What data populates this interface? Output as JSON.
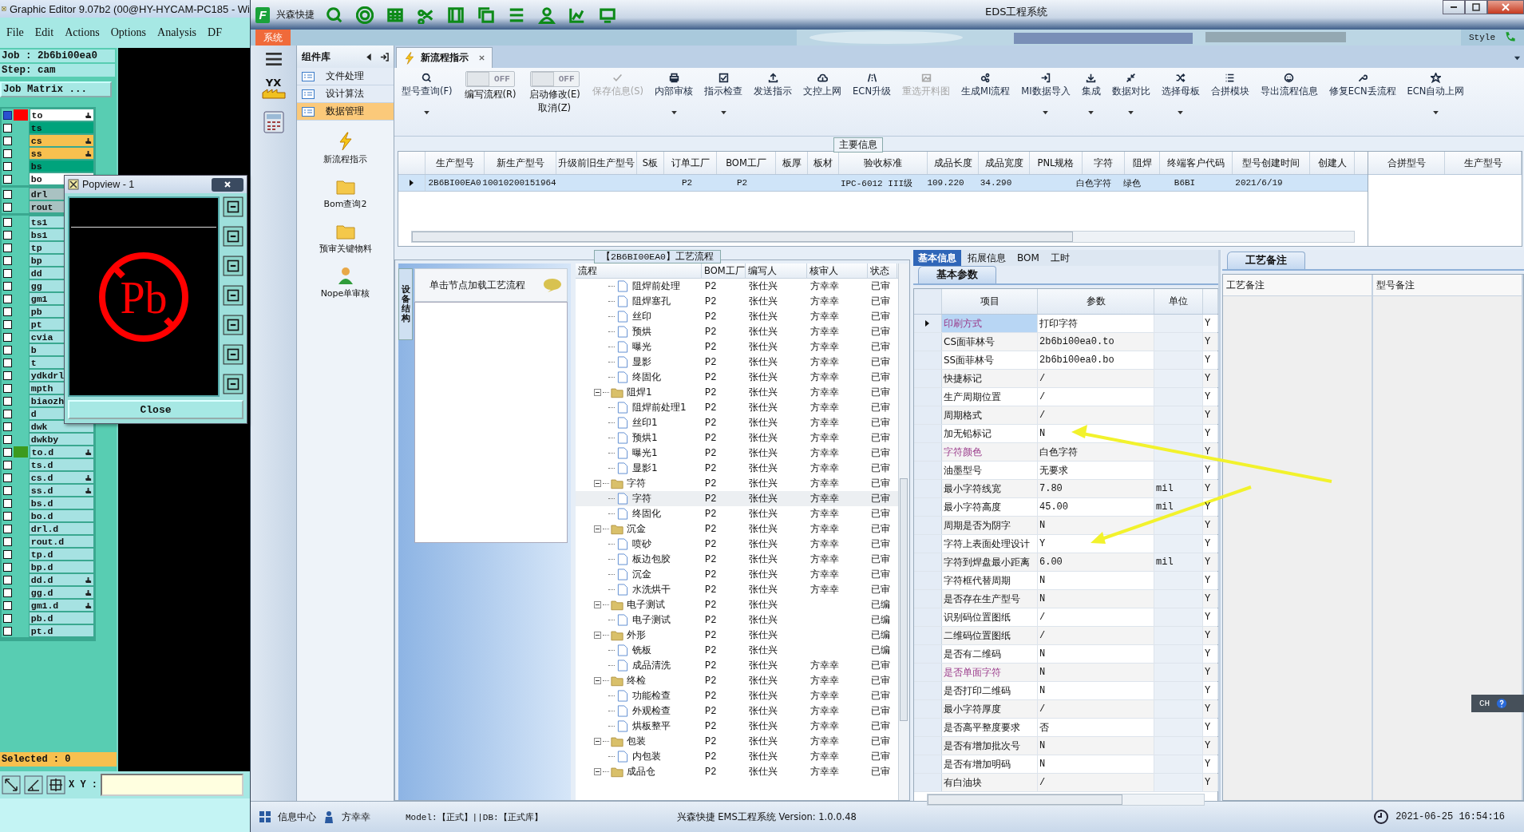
{
  "editor": {
    "title": "Graphic Editor 9.07b2 (00@HY-HYCAM-PC185 - Wi",
    "menu": [
      "File",
      "Edit",
      "Actions",
      "Options",
      "Analysis",
      "DF"
    ],
    "job": "Job : 2b6bi00ea0",
    "step": "Step: cam",
    "matrix_button": "Job Matrix ...",
    "layer_groups": [
      [
        {
          "name": "to",
          "color": "#ffffff",
          "swatch": {
            "color": "#ff0000"
          },
          "hand": true,
          "checked": true
        },
        {
          "name": "ts",
          "color": "#00a37c",
          "hand": false,
          "checked": false
        },
        {
          "name": "cs",
          "color": "#f7c04f",
          "hand": true,
          "checked": false
        },
        {
          "name": "ss",
          "color": "#f7c04f",
          "hand": true,
          "checked": false
        },
        {
          "name": "bs",
          "color": "#00a37c",
          "hand": false,
          "checked": false
        },
        {
          "name": "bo",
          "color": "#ffffff",
          "hand": false,
          "checked": false
        }
      ],
      [
        {
          "name": "drl",
          "color": "#a9c2c2",
          "hand": false,
          "checked": false
        },
        {
          "name": "rout",
          "color": "#a9c2c2",
          "hand": false,
          "checked": false
        }
      ],
      [
        {
          "name": "ts1",
          "color": "#a6e2e2",
          "hand": false,
          "checked": false
        },
        {
          "name": "bs1",
          "color": "#a6e2e2",
          "hand": false,
          "checked": false
        },
        {
          "name": "tp",
          "color": "#a6e2e2",
          "hand": false,
          "checked": false
        },
        {
          "name": "bp",
          "color": "#a6e2e2",
          "hand": false,
          "checked": false
        },
        {
          "name": "dd",
          "color": "#a6e2e2",
          "hand": false,
          "checked": false
        },
        {
          "name": "gg",
          "color": "#a6e2e2",
          "hand": false,
          "checked": false
        },
        {
          "name": "gm1",
          "color": "#a6e2e2",
          "hand": false,
          "checked": false
        },
        {
          "name": "pb",
          "color": "#a6e2e2",
          "hand": false,
          "checked": false
        },
        {
          "name": "pt",
          "color": "#a6e2e2",
          "hand": false,
          "checked": false
        },
        {
          "name": "cvia",
          "color": "#a6e2e2",
          "hand": false,
          "checked": false
        },
        {
          "name": "b",
          "color": "#a6e2e2",
          "hand": false,
          "checked": false
        },
        {
          "name": "t",
          "color": "#a6e2e2",
          "hand": false,
          "checked": false
        },
        {
          "name": "ydkdrl",
          "color": "#a6e2e2",
          "hand": false,
          "checked": false
        },
        {
          "name": "mpth",
          "color": "#a6e2e2",
          "hand": false,
          "checked": false
        },
        {
          "name": "biaozh",
          "color": "#a6e2e2",
          "hand": false,
          "checked": false
        },
        {
          "name": "d",
          "color": "#a6e2e2",
          "hand": false,
          "checked": false
        },
        {
          "name": "dwk",
          "color": "#a6e2e2",
          "hand": false,
          "checked": false
        },
        {
          "name": "dwkby",
          "color": "#a6e2e2",
          "hand": false,
          "checked": false
        },
        {
          "name": "to.d",
          "color": "#a6e2e2",
          "swatch": {
            "color": "#3c9a1e"
          },
          "hand": true,
          "checked": false
        },
        {
          "name": "ts.d",
          "color": "#a6e2e2",
          "hand": false,
          "checked": false
        },
        {
          "name": "cs.d",
          "color": "#a6e2e2",
          "hand": true,
          "checked": false
        },
        {
          "name": "ss.d",
          "color": "#a6e2e2",
          "hand": true,
          "checked": false
        },
        {
          "name": "bs.d",
          "color": "#a6e2e2",
          "hand": false,
          "checked": false
        },
        {
          "name": "bo.d",
          "color": "#a6e2e2",
          "hand": false,
          "checked": false
        },
        {
          "name": "drl.d",
          "color": "#a6e2e2",
          "hand": false,
          "checked": false
        },
        {
          "name": "rout.d",
          "color": "#a6e2e2",
          "hand": false,
          "checked": false
        },
        {
          "name": "tp.d",
          "color": "#a6e2e2",
          "hand": false,
          "checked": false
        },
        {
          "name": "bp.d",
          "color": "#a6e2e2",
          "hand": false,
          "checked": false
        },
        {
          "name": "dd.d",
          "color": "#a6e2e2",
          "hand": true,
          "checked": false
        },
        {
          "name": "gg.d",
          "color": "#a6e2e2",
          "hand": true,
          "checked": false
        },
        {
          "name": "gm1.d",
          "color": "#a6e2e2",
          "hand": true,
          "checked": false
        },
        {
          "name": "pb.d",
          "color": "#a6e2e2",
          "hand": false,
          "checked": false
        },
        {
          "name": "pt.d",
          "color": "#a6e2e2",
          "hand": false,
          "checked": false
        }
      ]
    ],
    "selected_count": "Selected : 0",
    "xy_label": "X Y :",
    "popview": {
      "title": "Popview - 1",
      "symbol": "Pb",
      "close_button": "Close"
    }
  },
  "app": {
    "logo": "F",
    "brand": "兴森快捷",
    "title": "EDS工程系统",
    "system_tab": "系统",
    "style_menu": "Style",
    "yx_logo": "YX"
  },
  "components": {
    "title": "组件库",
    "items": [
      {
        "label": "文件处理",
        "selected": false
      },
      {
        "label": "设计算法",
        "selected": false
      },
      {
        "label": "数据管理",
        "selected": true
      }
    ],
    "tools": [
      "新流程指示",
      "Bom查询2",
      "预审关键物料",
      "Nope单审核"
    ]
  },
  "doc_tab": "新流程指示",
  "toolbar": [
    {
      "kind": "button",
      "lines": [
        "型号查询(F)"
      ],
      "dropdown": true,
      "disabled": false
    },
    {
      "kind": "toggle",
      "toggle_text": "OFF",
      "on": false,
      "lines": [
        "编写流程(R)"
      ]
    },
    {
      "kind": "toggle",
      "toggle_text": "OFF",
      "on": false,
      "lines": [
        "启动修改(E)",
        "取消(Z)"
      ]
    },
    {
      "kind": "button",
      "lines": [
        "保存信息(S)"
      ],
      "dropdown": false,
      "disabled": true
    },
    {
      "kind": "button",
      "lines": [
        "内部审核"
      ],
      "dropdown": true,
      "disabled": false
    },
    {
      "kind": "button",
      "lines": [
        "指示检查"
      ],
      "dropdown": true,
      "disabled": false
    },
    {
      "kind": "button",
      "lines": [
        "发送指示"
      ],
      "dropdown": false,
      "disabled": false
    },
    {
      "kind": "button",
      "lines": [
        "文控上网"
      ],
      "dropdown": false,
      "disabled": false
    },
    {
      "kind": "button",
      "lines": [
        "ECN升级"
      ],
      "dropdown": false,
      "disabled": false
    },
    {
      "kind": "button",
      "lines": [
        "重选开料图"
      ],
      "dropdown": false,
      "disabled": true
    },
    {
      "kind": "button",
      "lines": [
        "生成MI流程"
      ],
      "dropdown": false,
      "disabled": false
    },
    {
      "kind": "button",
      "lines": [
        "MI数据导入"
      ],
      "dropdown": true,
      "disabled": false
    },
    {
      "kind": "button",
      "lines": [
        "集成"
      ],
      "dropdown": true,
      "disabled": false
    },
    {
      "kind": "button",
      "lines": [
        "数据对比"
      ],
      "dropdown": true,
      "disabled": false
    },
    {
      "kind": "button",
      "lines": [
        "选择母板"
      ],
      "dropdown": true,
      "disabled": false
    },
    {
      "kind": "button",
      "lines": [
        "合拼模块"
      ],
      "dropdown": false,
      "disabled": false
    },
    {
      "kind": "button",
      "lines": [
        "导出流程信息"
      ],
      "dropdown": false,
      "disabled": false
    },
    {
      "kind": "button",
      "lines": [
        "修复ECN丢流程"
      ],
      "dropdown": false,
      "disabled": false
    },
    {
      "kind": "button",
      "lines": [
        "ECN自动上网"
      ],
      "dropdown": true,
      "disabled": false
    }
  ],
  "main_info": {
    "title": "主要信息",
    "columns": [
      {
        "header": "生产型号",
        "value": "2B6BI00EA0"
      },
      {
        "header": "新生产型号",
        "value": "10010200151964"
      },
      {
        "header": "升级前旧生产型号"
      },
      {
        "header": "S板"
      },
      {
        "header": "订单工厂",
        "value": "P2"
      },
      {
        "header": "BOM工厂",
        "value": "P2"
      },
      {
        "header": "板厚"
      },
      {
        "header": "板材"
      },
      {
        "header": "验收标准",
        "value": "IPC-6012 III级"
      },
      {
        "header": "成品长度",
        "value": "109.220"
      },
      {
        "header": "成品宽度",
        "value": "34.290"
      },
      {
        "header": "PNL规格"
      },
      {
        "header": "字符",
        "value": "白色字符"
      },
      {
        "header": "阻焊",
        "value": "绿色"
      },
      {
        "header": "终端客户代码",
        "value": "B6BI"
      },
      {
        "header": "型号创建时间",
        "value": "2021/6/19"
      },
      {
        "header": "创建人"
      }
    ],
    "side_columns": [
      "合拼型号",
      "生产型号"
    ]
  },
  "process": {
    "title": "【2B6BI00EA0】工艺流程",
    "side_tab": "设备结构",
    "hint": "单击节点加载工艺流程",
    "columns": [
      "流程",
      "BOM工厂",
      "编写人",
      "核审人",
      "状态"
    ],
    "rows": [
      {
        "kind": "step",
        "name": "阻焊前处理",
        "bom": "P2",
        "writer": "张仕兴",
        "reviewer": "方幸幸",
        "status": "已审",
        "selected": false
      },
      {
        "kind": "step",
        "name": "阻焊塞孔",
        "bom": "P2",
        "writer": "张仕兴",
        "reviewer": "方幸幸",
        "status": "已审",
        "selected": false
      },
      {
        "kind": "step",
        "name": "丝印",
        "bom": "P2",
        "writer": "张仕兴",
        "reviewer": "方幸幸",
        "status": "已审",
        "selected": false
      },
      {
        "kind": "step",
        "name": "预烘",
        "bom": "P2",
        "writer": "张仕兴",
        "reviewer": "方幸幸",
        "status": "已审",
        "selected": false
      },
      {
        "kind": "step",
        "name": "曝光",
        "bom": "P2",
        "writer": "张仕兴",
        "reviewer": "方幸幸",
        "status": "已审",
        "selected": false
      },
      {
        "kind": "step",
        "name": "显影",
        "bom": "P2",
        "writer": "张仕兴",
        "reviewer": "方幸幸",
        "status": "已审",
        "selected": false
      },
      {
        "kind": "step",
        "name": "终固化",
        "bom": "P2",
        "writer": "张仕兴",
        "reviewer": "方幸幸",
        "status": "已审",
        "selected": false
      },
      {
        "kind": "group",
        "name": "阻焊1",
        "bom": "P2",
        "writer": "张仕兴",
        "reviewer": "方幸幸",
        "status": "已审",
        "selected": false,
        "expanded": true,
        "children": [
          {
            "kind": "step",
            "name": "阻焊前处理1",
            "bom": "P2",
            "writer": "张仕兴",
            "reviewer": "方幸幸",
            "status": "已审",
            "selected": false
          },
          {
            "kind": "step",
            "name": "丝印1",
            "bom": "P2",
            "writer": "张仕兴",
            "reviewer": "方幸幸",
            "status": "已审",
            "selected": false
          },
          {
            "kind": "step",
            "name": "预烘1",
            "bom": "P2",
            "writer": "张仕兴",
            "reviewer": "方幸幸",
            "status": "已审",
            "selected": false
          },
          {
            "kind": "step",
            "name": "曝光1",
            "bom": "P2",
            "writer": "张仕兴",
            "reviewer": "方幸幸",
            "status": "已审",
            "selected": false
          },
          {
            "kind": "step",
            "name": "显影1",
            "bom": "P2",
            "writer": "张仕兴",
            "reviewer": "方幸幸",
            "status": "已审",
            "selected": false
          }
        ]
      },
      {
        "kind": "group",
        "name": "字符",
        "bom": "P2",
        "writer": "张仕兴",
        "reviewer": "方幸幸",
        "status": "已审",
        "selected": false,
        "expanded": true,
        "children": [
          {
            "kind": "step",
            "name": "字符",
            "bom": "P2",
            "writer": "张仕兴",
            "reviewer": "方幸幸",
            "status": "已审",
            "selected": true
          },
          {
            "kind": "step",
            "name": "终固化",
            "bom": "P2",
            "writer": "张仕兴",
            "reviewer": "方幸幸",
            "status": "已审",
            "selected": false
          }
        ]
      },
      {
        "kind": "group",
        "name": "沉金",
        "bom": "P2",
        "writer": "张仕兴",
        "reviewer": "方幸幸",
        "status": "已审",
        "selected": false,
        "expanded": true,
        "children": [
          {
            "kind": "step",
            "name": "喷砂",
            "bom": "P2",
            "writer": "张仕兴",
            "reviewer": "方幸幸",
            "status": "已审",
            "selected": false
          },
          {
            "kind": "step",
            "name": "板边包胶",
            "bom": "P2",
            "writer": "张仕兴",
            "reviewer": "方幸幸",
            "status": "已审",
            "selected": false
          },
          {
            "kind": "step",
            "name": "沉金",
            "bom": "P2",
            "writer": "张仕兴",
            "reviewer": "方幸幸",
            "status": "已审",
            "selected": false
          },
          {
            "kind": "step",
            "name": "水洗烘干",
            "bom": "P2",
            "writer": "张仕兴",
            "reviewer": "方幸幸",
            "status": "已审",
            "selected": false
          }
        ]
      },
      {
        "kind": "group",
        "name": "电子测试",
        "bom": "P2",
        "writer": "张仕兴",
        "status": "已编",
        "selected": false,
        "expanded": true,
        "children": [
          {
            "kind": "step",
            "name": "电子测试",
            "bom": "P2",
            "writer": "张仕兴",
            "status": "已编",
            "selected": false
          }
        ]
      },
      {
        "kind": "group",
        "name": "外形",
        "bom": "P2",
        "writer": "张仕兴",
        "status": "已编",
        "selected": false,
        "expanded": true,
        "children": [
          {
            "kind": "step",
            "name": "铣板",
            "bom": "P2",
            "writer": "张仕兴",
            "status": "已编",
            "selected": false
          },
          {
            "kind": "step",
            "name": "成品清洗",
            "bom": "P2",
            "writer": "张仕兴",
            "reviewer": "方幸幸",
            "status": "已审",
            "selected": false
          }
        ]
      },
      {
        "kind": "group",
        "name": "终检",
        "bom": "P2",
        "writer": "张仕兴",
        "reviewer": "方幸幸",
        "status": "已审",
        "selected": false,
        "expanded": true,
        "children": [
          {
            "kind": "step",
            "name": "功能检查",
            "bom": "P2",
            "writer": "张仕兴",
            "reviewer": "方幸幸",
            "status": "已审",
            "selected": false
          },
          {
            "kind": "step",
            "name": "外观检查",
            "bom": "P2",
            "writer": "张仕兴",
            "reviewer": "方幸幸",
            "status": "已审",
            "selected": false
          },
          {
            "kind": "step",
            "name": "烘板整平",
            "bom": "P2",
            "writer": "张仕兴",
            "reviewer": "方幸幸",
            "status": "已审",
            "selected": false
          }
        ]
      },
      {
        "kind": "group",
        "name": "包装",
        "bom": "P2",
        "writer": "张仕兴",
        "reviewer": "方幸幸",
        "status": "已审",
        "selected": false,
        "expanded": true,
        "children": [
          {
            "kind": "step",
            "name": "内包装",
            "bom": "P2",
            "writer": "张仕兴",
            "reviewer": "方幸幸",
            "status": "已审",
            "selected": false
          }
        ]
      },
      {
        "kind": "group",
        "name": "成品仓",
        "bom": "P2",
        "writer": "张仕兴",
        "reviewer": "方幸幸",
        "status": "已审",
        "selected": false,
        "expanded": true
      }
    ]
  },
  "params": {
    "tabs": [
      {
        "label": "基本信息",
        "selected": true
      },
      {
        "label": "拓展信息",
        "selected": false
      },
      {
        "label": "BOM",
        "selected": false
      },
      {
        "label": "工时",
        "selected": false
      }
    ],
    "subtab": "基本参数",
    "columns": [
      "项目",
      "参数",
      "单位"
    ],
    "rows": [
      {
        "item": "印刷方式",
        "value": "打印字符",
        "flag": "Y",
        "highlight": true,
        "selected": true
      },
      {
        "item": "CS面菲林号",
        "value": "2b6bi00ea0.to",
        "flag": "Y",
        "highlight": false,
        "selected": false
      },
      {
        "item": "SS面菲林号",
        "value": "2b6bi00ea0.bo",
        "flag": "Y",
        "highlight": false,
        "selected": false
      },
      {
        "item": "快捷标记",
        "value": "/",
        "flag": "Y",
        "highlight": false,
        "selected": false
      },
      {
        "item": "生产周期位置",
        "value": "/",
        "flag": "Y",
        "highlight": false,
        "selected": false
      },
      {
        "item": "周期格式",
        "value": "/",
        "flag": "Y",
        "highlight": false,
        "selected": false
      },
      {
        "item": "加无铅标记",
        "value": "N",
        "flag": "Y",
        "highlight": false,
        "selected": false
      },
      {
        "item": "字符颜色",
        "value": "白色字符",
        "flag": "Y",
        "highlight": true,
        "selected": false
      },
      {
        "item": "油墨型号",
        "value": "无要求",
        "flag": "Y",
        "highlight": false,
        "selected": false
      },
      {
        "item": "最小字符线宽",
        "value": "7.80",
        "unit": "mil",
        "flag": "Y",
        "highlight": false,
        "selected": false
      },
      {
        "item": "最小字符高度",
        "value": "45.00",
        "unit": "mil",
        "flag": "Y",
        "highlight": false,
        "selected": false
      },
      {
        "item": "周期是否为阴字",
        "value": "N",
        "flag": "Y",
        "highlight": false,
        "selected": false
      },
      {
        "item": "字符上表面处理设计",
        "value": "Y",
        "flag": "Y",
        "highlight": false,
        "selected": false
      },
      {
        "item": "字符到焊盘最小距离",
        "value": "6.00",
        "unit": "mil",
        "flag": "Y",
        "highlight": false,
        "selected": false
      },
      {
        "item": "字符框代替周期",
        "value": "N",
        "flag": "Y",
        "highlight": false,
        "selected": false
      },
      {
        "item": "是否存在生产型号",
        "value": "N",
        "flag": "Y",
        "highlight": false,
        "selected": false
      },
      {
        "item": "识别码位置图纸",
        "value": "/",
        "flag": "Y",
        "highlight": false,
        "selected": false
      },
      {
        "item": "二维码位置图纸",
        "value": "/",
        "flag": "Y",
        "highlight": false,
        "selected": false
      },
      {
        "item": "是否有二维码",
        "value": "N",
        "flag": "Y",
        "highlight": false,
        "selected": false
      },
      {
        "item": "是否单面字符",
        "value": "N",
        "flag": "Y",
        "highlight": true,
        "selected": false
      },
      {
        "item": "是否打印二维码",
        "value": "N",
        "flag": "Y",
        "highlight": false,
        "selected": false
      },
      {
        "item": "最小字符厚度",
        "value": "/",
        "flag": "Y",
        "highlight": false,
        "selected": false
      },
      {
        "item": "是否高平整度要求",
        "value": "否",
        "flag": "Y",
        "highlight": false,
        "selected": false
      },
      {
        "item": "是否有增加批次号",
        "value": "N",
        "flag": "Y",
        "highlight": false,
        "selected": false
      },
      {
        "item": "是否有增加明码",
        "value": "N",
        "flag": "Y",
        "highlight": false,
        "selected": false
      },
      {
        "item": "有白油块",
        "value": "/",
        "flag": "Y",
        "highlight": false,
        "selected": false
      }
    ]
  },
  "notes": {
    "tab": "工艺备注",
    "columns": [
      "工艺备注",
      "型号备注"
    ]
  },
  "ime": {
    "label": "CH"
  },
  "status_bar": {
    "center": "信息中心",
    "user": "方幸幸",
    "model": "Model:【正式】||DB:【正式库】",
    "version": "兴森快捷 EMS工程系统 Version: 1.0.0.48",
    "datetime": "2021-06-25 16:54:16"
  }
}
